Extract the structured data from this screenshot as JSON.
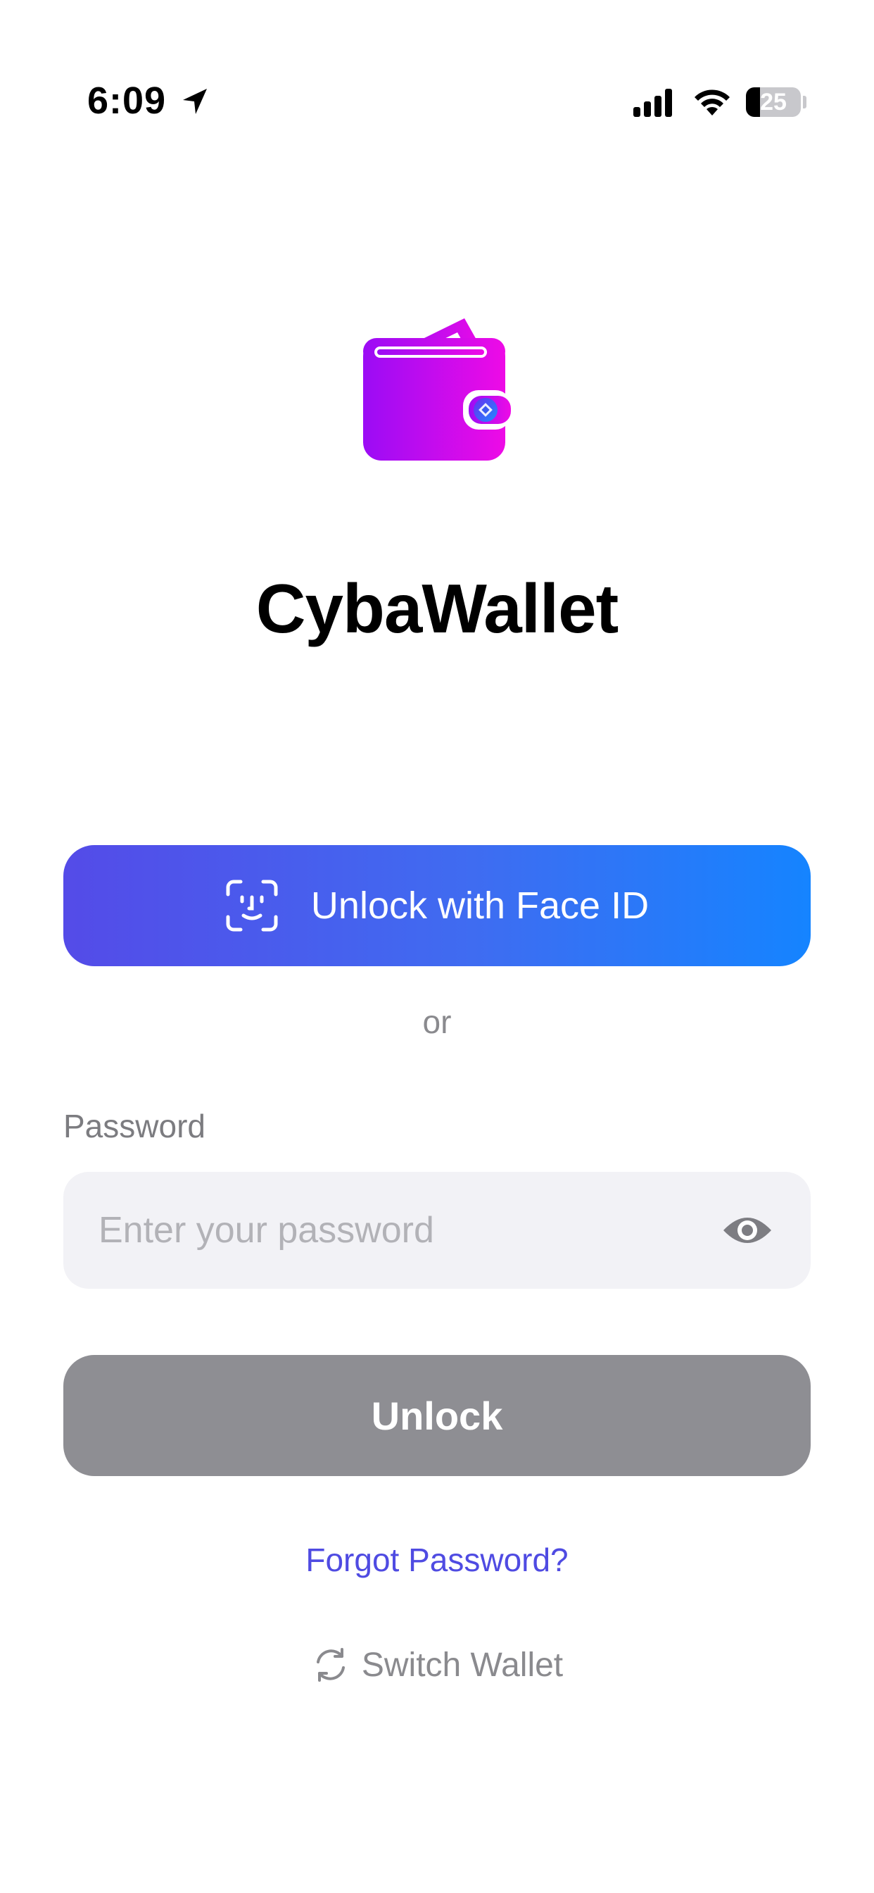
{
  "status_bar": {
    "time": "6:09",
    "battery_level": "25",
    "battery_fraction": 0.25
  },
  "app": {
    "title": "CybaWallet",
    "brand_gradient": [
      "#9b0cf5",
      "#ee0be6"
    ],
    "accent": "#4f4be2"
  },
  "faceid_button": {
    "label": "Unlock with Face ID",
    "icon": "face-id-icon",
    "gradient": [
      "#544be8",
      "#1584ff"
    ]
  },
  "divider": {
    "text": "or"
  },
  "password": {
    "label": "Password",
    "placeholder": "Enter your password",
    "value": "",
    "toggle_icon": "eye-icon"
  },
  "unlock_button": {
    "label": "Unlock",
    "color": "#8e8e93"
  },
  "forgot_password": {
    "label": "Forgot Password?"
  },
  "switch_wallet": {
    "label": "Switch Wallet",
    "icon": "refresh-icon"
  }
}
